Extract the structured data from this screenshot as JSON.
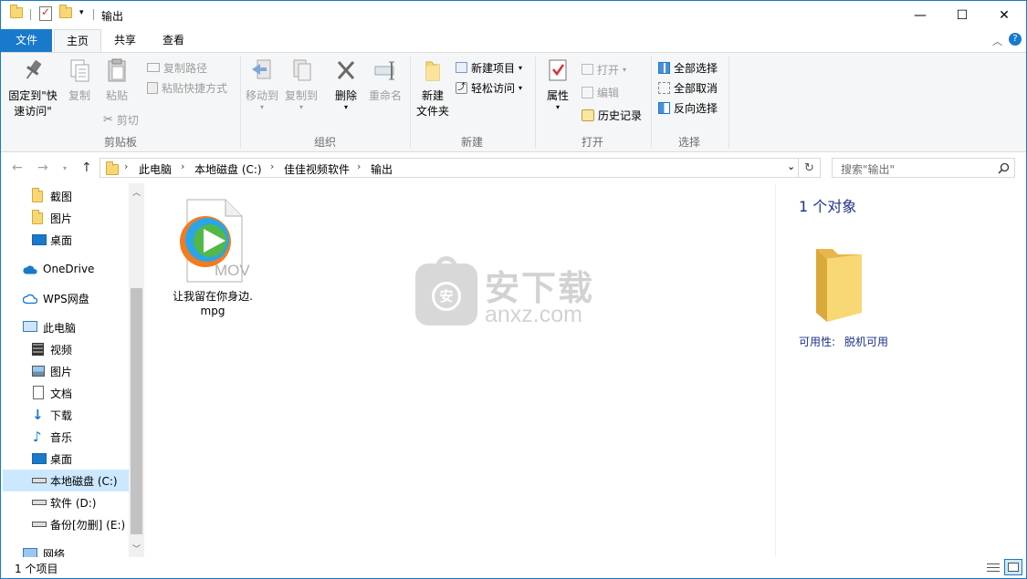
{
  "window": {
    "title": "输出",
    "controls": {
      "minimize": "—",
      "maximize": "☐",
      "close": "✕"
    }
  },
  "tabs": [
    {
      "label": "文件"
    },
    {
      "label": "主页"
    },
    {
      "label": "共享"
    },
    {
      "label": "查看"
    }
  ],
  "ribbon": {
    "clipboard": {
      "label": "剪贴板",
      "pin_line1": "固定到\"快",
      "pin_line2": "速访问\"",
      "copy": "复制",
      "paste": "粘贴",
      "copy_path": "复制路径",
      "paste_shortcut": "粘贴快捷方式",
      "cut": "剪切"
    },
    "organize": {
      "label": "组织",
      "move_to": "移动到",
      "copy_to": "复制到",
      "delete": "删除",
      "rename": "重命名"
    },
    "new": {
      "label": "新建",
      "new_folder_line1": "新建",
      "new_folder_line2": "文件夹",
      "new_item": "新建项目",
      "easy_access": "轻松访问"
    },
    "open": {
      "label": "打开",
      "properties": "属性",
      "open": "打开",
      "edit": "编辑",
      "history": "历史记录"
    },
    "select": {
      "label": "选择",
      "select_all": "全部选择",
      "select_none": "全部取消",
      "invert": "反向选择"
    }
  },
  "address": {
    "crumbs": [
      "此电脑",
      "本地磁盘 (C:)",
      "佳佳视频软件",
      "输出"
    ],
    "search_placeholder": "搜索\"输出\""
  },
  "nav": {
    "items": [
      {
        "label": "截图",
        "icon": "folder-icon"
      },
      {
        "label": "图片",
        "icon": "folder-icon"
      },
      {
        "label": "桌面",
        "icon": "desktop-icon"
      },
      {
        "label": "OneDrive",
        "icon": "cloud-icon"
      },
      {
        "label": "WPS网盘",
        "icon": "cloud-icon"
      },
      {
        "label": "此电脑",
        "icon": "computer-icon"
      },
      {
        "label": "视频",
        "icon": "video-icon"
      },
      {
        "label": "图片",
        "icon": "picture-icon"
      },
      {
        "label": "文档",
        "icon": "document-icon"
      },
      {
        "label": "下载",
        "icon": "download-icon"
      },
      {
        "label": "音乐",
        "icon": "music-icon"
      },
      {
        "label": "桌面",
        "icon": "desktop-icon"
      },
      {
        "label": "本地磁盘 (C:)",
        "icon": "drive-icon"
      },
      {
        "label": "软件 (D:)",
        "icon": "drive-icon"
      },
      {
        "label": "备份[勿删] (E:)",
        "icon": "drive-icon"
      },
      {
        "label": "网络",
        "icon": "network-icon"
      }
    ]
  },
  "files": [
    {
      "name_line1": "让我留在你身边.",
      "name_line2": "mpg",
      "badge": "MOV"
    }
  ],
  "watermark": {
    "text_cn": "安下载",
    "text_en": "anxz.com",
    "badge": "安"
  },
  "preview": {
    "count": "1 个对象",
    "availability_label": "可用性:",
    "availability_value": "脱机可用"
  },
  "status": {
    "count": "1 个项目"
  },
  "colors": {
    "accent": "#1979ca",
    "selected": "#cce8ff",
    "folder": "#f8d775"
  }
}
